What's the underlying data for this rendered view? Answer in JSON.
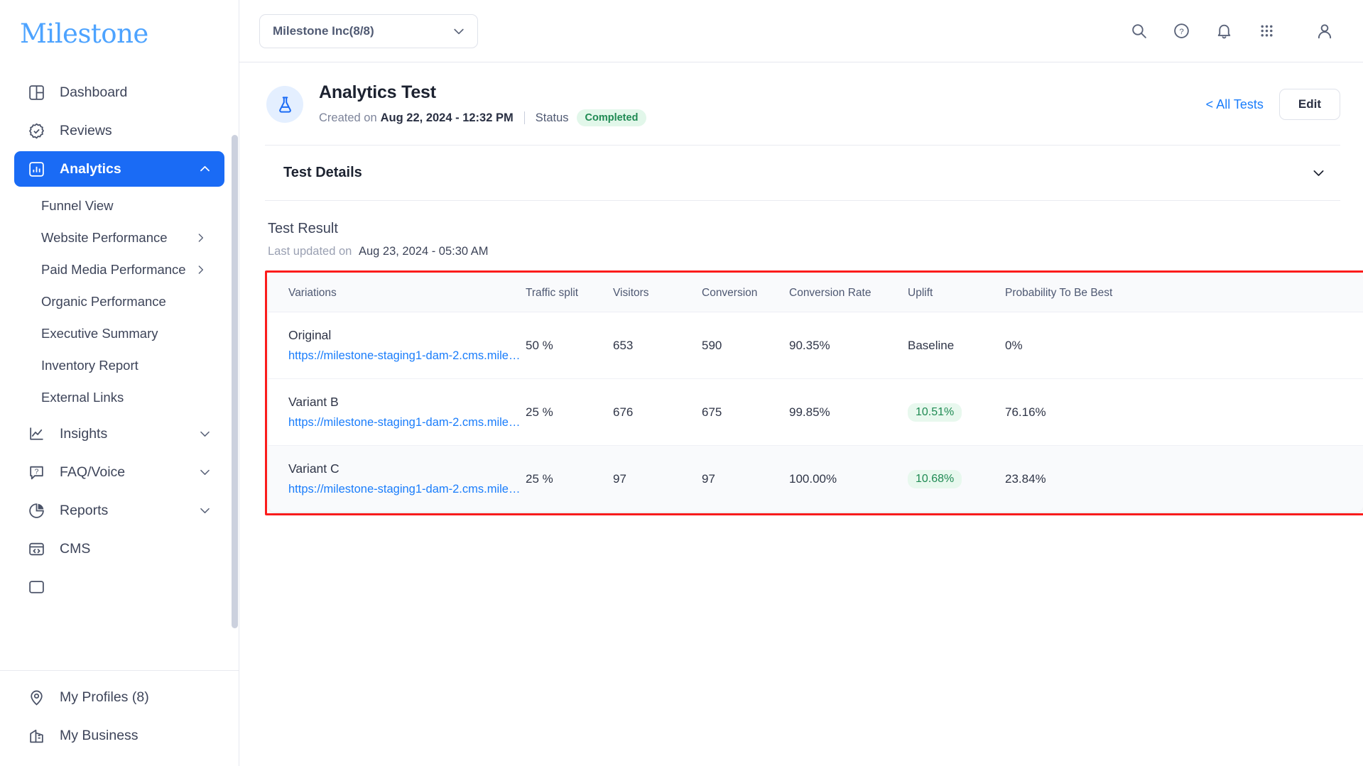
{
  "brand": {
    "logo_text": "Milestone"
  },
  "sidebar": {
    "items": [
      {
        "label": "Dashboard",
        "icon": "dashboard-icon"
      },
      {
        "label": "Reviews",
        "icon": "check-badge-icon"
      },
      {
        "label": "Analytics",
        "icon": "bar-chart-icon",
        "active": true,
        "chevron": "chevron-up-icon"
      }
    ],
    "analytics_children": [
      {
        "label": "Funnel View"
      },
      {
        "label": "Website Performance",
        "chevron": "chevron-right-icon"
      },
      {
        "label": "Paid Media Performance",
        "chevron": "chevron-right-icon"
      },
      {
        "label": "Organic Performance"
      },
      {
        "label": "Executive Summary"
      },
      {
        "label": "Inventory Report"
      },
      {
        "label": "External Links"
      }
    ],
    "items_after": [
      {
        "label": "Insights",
        "icon": "line-chart-icon",
        "chevron": "chevron-down-icon"
      },
      {
        "label": "FAQ/Voice",
        "icon": "question-chat-icon",
        "chevron": "chevron-down-icon"
      },
      {
        "label": "Reports",
        "icon": "pie-chart-icon",
        "chevron": "chevron-down-icon"
      },
      {
        "label": "CMS",
        "icon": "code-window-icon"
      }
    ],
    "bottom_items": [
      {
        "label": "My Profiles (8)",
        "icon": "location-pin-icon"
      },
      {
        "label": "My Business",
        "icon": "building-icon"
      }
    ]
  },
  "topbar": {
    "org_selector": {
      "value": "Milestone Inc(8/8)",
      "chevron": "chevron-down-icon"
    },
    "icons": [
      {
        "name": "search-icon"
      },
      {
        "name": "help-circle-icon"
      },
      {
        "name": "notification-bell-icon"
      },
      {
        "name": "apps-grid-icon"
      },
      {
        "name": "user-account-icon"
      }
    ]
  },
  "page": {
    "icon": "flask-icon",
    "title": "Analytics Test",
    "created_prefix": "Created on",
    "created_date": "Aug 22, 2024 - 12:32 PM",
    "status_label": "Status",
    "status_value": "Completed",
    "all_tests_link": "< All Tests",
    "edit_button": "Edit"
  },
  "test_details": {
    "title": "Test Details",
    "chevron": "chevron-down-icon"
  },
  "test_result": {
    "title": "Test Result",
    "updated_prefix": "Last updated on",
    "updated_date": "Aug 23, 2024 - 05:30 AM"
  },
  "table": {
    "columns": [
      "Variations",
      "Traffic split",
      "Visitors",
      "Conversion",
      "Conversion Rate",
      "Uplift",
      "Probability To Be Best"
    ],
    "rows": [
      {
        "variation": "Original",
        "url": "https://milestone-staging1-dam-2.cms.miles...",
        "traffic_split": "50 %",
        "visitors": "653",
        "conversion": "590",
        "conversion_rate": "90.35%",
        "uplift": "Baseline",
        "uplift_is_pill": false,
        "probability": "0%"
      },
      {
        "variation": "Variant B",
        "url": "https://milestone-staging1-dam-2.cms.miles...",
        "traffic_split": "25 %",
        "visitors": "676",
        "conversion": "675",
        "conversion_rate": "99.85%",
        "uplift": "10.51%",
        "uplift_is_pill": true,
        "probability": "76.16%"
      },
      {
        "variation": "Variant C",
        "url": "https://milestone-staging1-dam-2.cms.miles...",
        "traffic_split": "25 %",
        "visitors": "97",
        "conversion": "97",
        "conversion_rate": "100.00%",
        "uplift": "10.68%",
        "uplift_is_pill": true,
        "probability": "23.84%"
      }
    ]
  },
  "colors": {
    "accent_blue": "#1a6bf5",
    "link_blue": "#1a7dfb",
    "logo_blue": "#4da3ff",
    "success_green": "#1f8a53",
    "success_bg": "#e2f7ea",
    "highlight_red": "#fc1c1c"
  }
}
